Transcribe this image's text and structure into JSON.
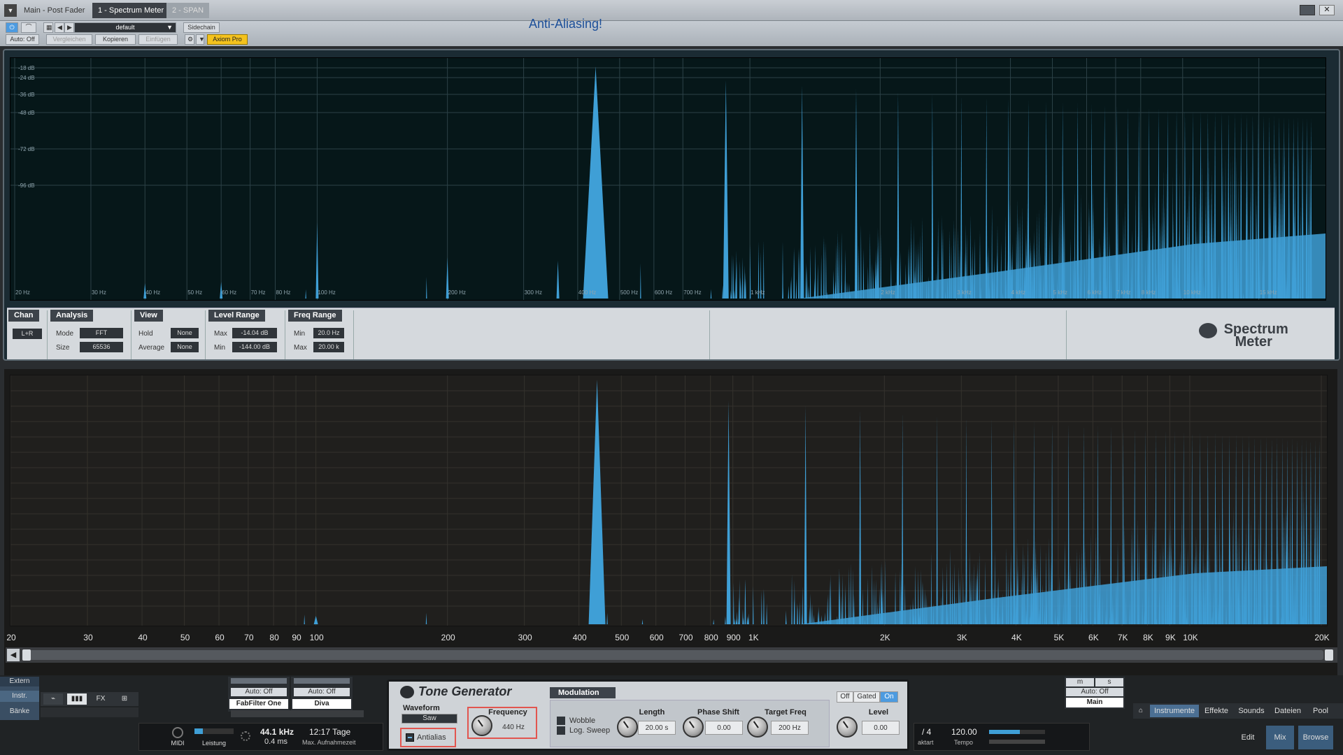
{
  "titlebar": {
    "menu_icon": "chevron-down-icon",
    "tabs": [
      {
        "label": "Main - Post Fader"
      },
      {
        "label": "1 - Spectrum Meter"
      },
      {
        "label": "2 - SPAN"
      }
    ]
  },
  "toolbar": {
    "preset": "default",
    "sidechain": "Sidechain",
    "auto": "Auto: Off",
    "compare": "Vergleichen",
    "copy": "Kopieren",
    "paste": "Einfügen",
    "device": "Axiom Pro"
  },
  "annotation": "Anti-Aliasing!",
  "upper": {
    "db_labels": [
      "-18 dB",
      "-24 dB",
      "-36 dB",
      "-48 dB",
      "-72 dB",
      "-96 dB"
    ],
    "freq_labels": [
      "20 Hz",
      "30 Hz",
      "40 Hz",
      "50 Hz",
      "60 Hz",
      "70 Hz",
      "80 Hz",
      "100 Hz",
      "200 Hz",
      "300 Hz",
      "400 Hz",
      "500 Hz",
      "600 Hz",
      "700 Hz",
      "1 kHz",
      "2 kHz",
      "3 kHz",
      "4 kHz",
      "5 kHz",
      "6 kHz",
      "7 kHz",
      "8 kHz",
      "10 kHz",
      "15 kHz"
    ]
  },
  "controls": {
    "chan": {
      "title": "Chan",
      "value": "L+R"
    },
    "analysis": {
      "title": "Analysis",
      "mode_label": "Mode",
      "mode": "FFT",
      "size_label": "Size",
      "size": "65536"
    },
    "view": {
      "title": "View",
      "hold_label": "Hold",
      "hold": "None",
      "average_label": "Average",
      "average": "None"
    },
    "level_range": {
      "title": "Level Range",
      "max_label": "Max",
      "max": "-14.04 dB",
      "min_label": "Min",
      "min": "-144.00 dB"
    },
    "freq_range": {
      "title": "Freq Range",
      "min_label": "Min",
      "min": "20.0 Hz",
      "max_label": "Max",
      "max": "20.00 k"
    },
    "logo_line1": "Spectrum",
    "logo_line2": "Meter"
  },
  "lower": {
    "freq_labels": [
      "20",
      "30",
      "40",
      "50",
      "60",
      "70",
      "80",
      "90",
      "100",
      "200",
      "300",
      "400",
      "500",
      "600",
      "700",
      "800",
      "900",
      "1K",
      "2K",
      "3K",
      "4K",
      "5K",
      "6K",
      "7K",
      "8K",
      "9K",
      "10K",
      "20K"
    ]
  },
  "mixer": {
    "extern": "Extern",
    "instr": "Instr.",
    "banks": "Bänke",
    "ch1_auto": "Auto: Off",
    "ch1_name": "FabFilter One",
    "ch2_auto": "Auto: Off",
    "ch2_name": "Diva",
    "main_auto": "Auto: Off",
    "main_name": "Main",
    "m": "m",
    "s": "s"
  },
  "status": {
    "midi": "MIDI",
    "performance": "Leistung",
    "samplerate": "44.1 kHz",
    "latency": "0.4 ms",
    "time": "12:17 Tage",
    "rec_time": "Max. Aufnahmezeit",
    "signature": "/ 4",
    "signature_label": "aktart",
    "tempo": "120.00",
    "tempo_label": "Tempo"
  },
  "tone_generator": {
    "title": "Tone Generator",
    "modulation": "Modulation",
    "waveform_label": "Waveform",
    "waveform": "Saw",
    "antialias": "Antialias",
    "frequency_label": "Frequency",
    "frequency": "440 Hz",
    "wobble": "Wobble",
    "log_sweep": "Log. Sweep",
    "length_label": "Length",
    "length": "20.00 s",
    "phase_label": "Phase Shift",
    "phase": "0.00",
    "target_label": "Target Freq",
    "target": "200 Hz",
    "gate_off": "Off",
    "gate_gated": "Gated",
    "gate_on": "On",
    "level_label": "Level",
    "level": "0.00"
  },
  "browser_tabs": [
    "Instrumente",
    "Effekte",
    "Sounds",
    "Dateien",
    "Pool"
  ],
  "views": [
    "Edit",
    "Mix",
    "Browse"
  ],
  "colors": {
    "spectrum": "#3f9fd6",
    "accent": "#f4c21d",
    "highlight": "#e2554f"
  }
}
